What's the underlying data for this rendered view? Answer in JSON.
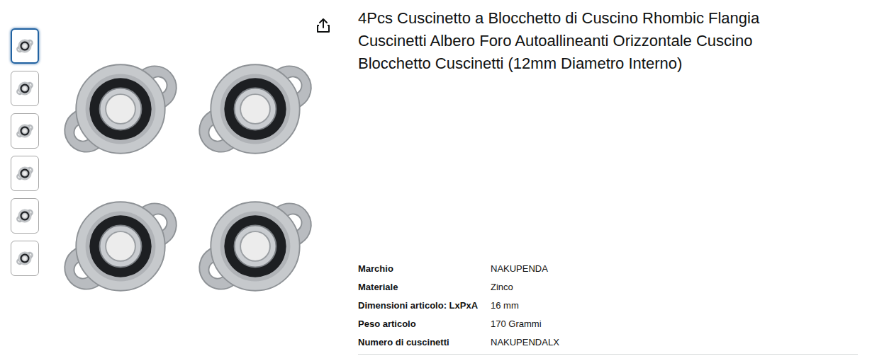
{
  "thumbnails": [
    {
      "selected": true
    },
    {
      "selected": false
    },
    {
      "selected": false
    },
    {
      "selected": false
    },
    {
      "selected": false
    },
    {
      "selected": false
    }
  ],
  "title": "4Pcs Cuscinetto a Blocchetto di Cuscino Rhombic Flangia Cuscinetti Albero Foro Autoallineanti Orizzontale Cuscino Blocchetto Cuscinetti (12mm Diametro Interno)",
  "specs": [
    {
      "label": "Marchio",
      "value": "NAKUPENDA"
    },
    {
      "label": "Materiale",
      "value": "Zinco"
    },
    {
      "label": "Dimensioni articolo: LxPxA",
      "value": "16 mm"
    },
    {
      "label": "Peso articolo",
      "value": "170 Grammi"
    },
    {
      "label": "Numero di cuscinetti",
      "value": "NAKUPENDALX"
    }
  ]
}
